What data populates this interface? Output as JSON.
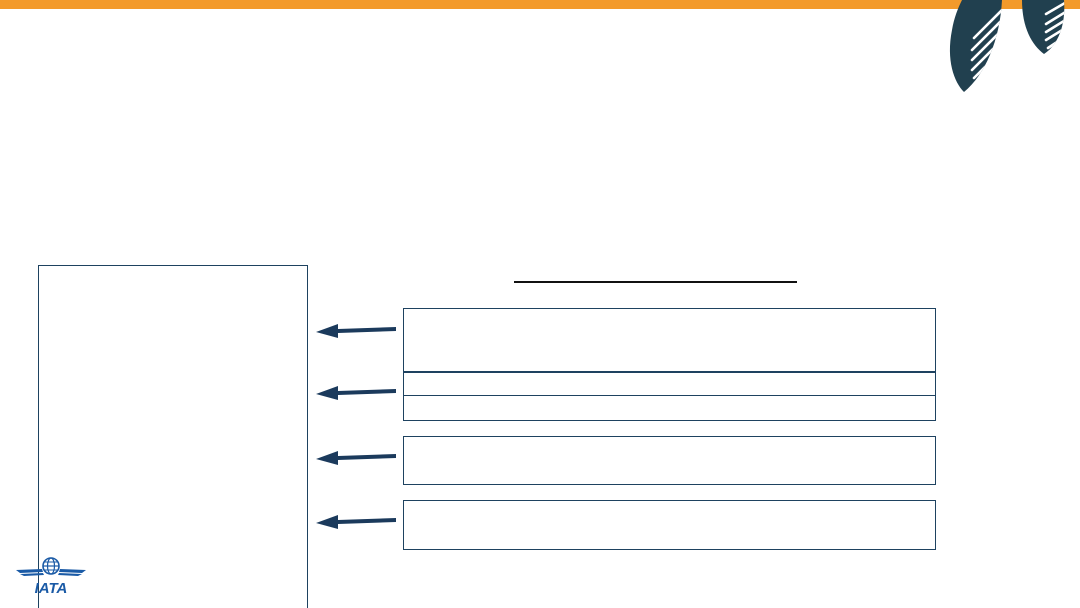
{
  "colors": {
    "accent_orange": "#f39a2b",
    "navy": "#1e4260",
    "arrow": "#1b3a5c",
    "logo_blue": "#1a5aa6"
  },
  "logo": {
    "text": "IATA"
  },
  "icons": [
    "leaf-stripes-icon",
    "left-arrow-icon",
    "globe-icon"
  ]
}
